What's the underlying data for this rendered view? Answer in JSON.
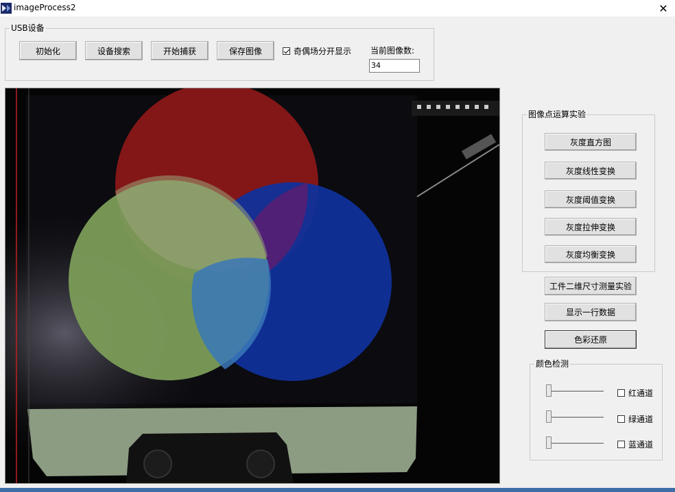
{
  "window": {
    "title": "imageProcess2"
  },
  "usb_group": {
    "legend": "USB设备",
    "buttons": {
      "init": "初始化",
      "search": "设备搜索",
      "capture": "开始捕获",
      "save": "保存图像"
    },
    "split_checkbox": {
      "label": "奇偶场分开显示",
      "checked": true
    },
    "count_label": "当前图像数:",
    "count_value": "34"
  },
  "point_ops_group": {
    "legend": "图像点运算实验",
    "buttons": {
      "histogram": "灰度直方图",
      "linear": "灰度线性变换",
      "threshold": "灰度阈值变换",
      "stretch": "灰度拉伸变换",
      "equalize": "灰度均衡变换"
    }
  },
  "extra_buttons": {
    "measure": "工件二维尺寸测量实验",
    "show_row": "显示一行数据",
    "color_restore": "色彩还原"
  },
  "color_group": {
    "legend": "颜色检测",
    "channels": [
      {
        "label": "红通道",
        "checked": false,
        "level": 0
      },
      {
        "label": "绿通道",
        "checked": false,
        "level": 0
      },
      {
        "label": "蓝通道",
        "checked": false,
        "level": 0
      }
    ]
  },
  "colors": {
    "accent_strip": "#3d6fa6"
  }
}
